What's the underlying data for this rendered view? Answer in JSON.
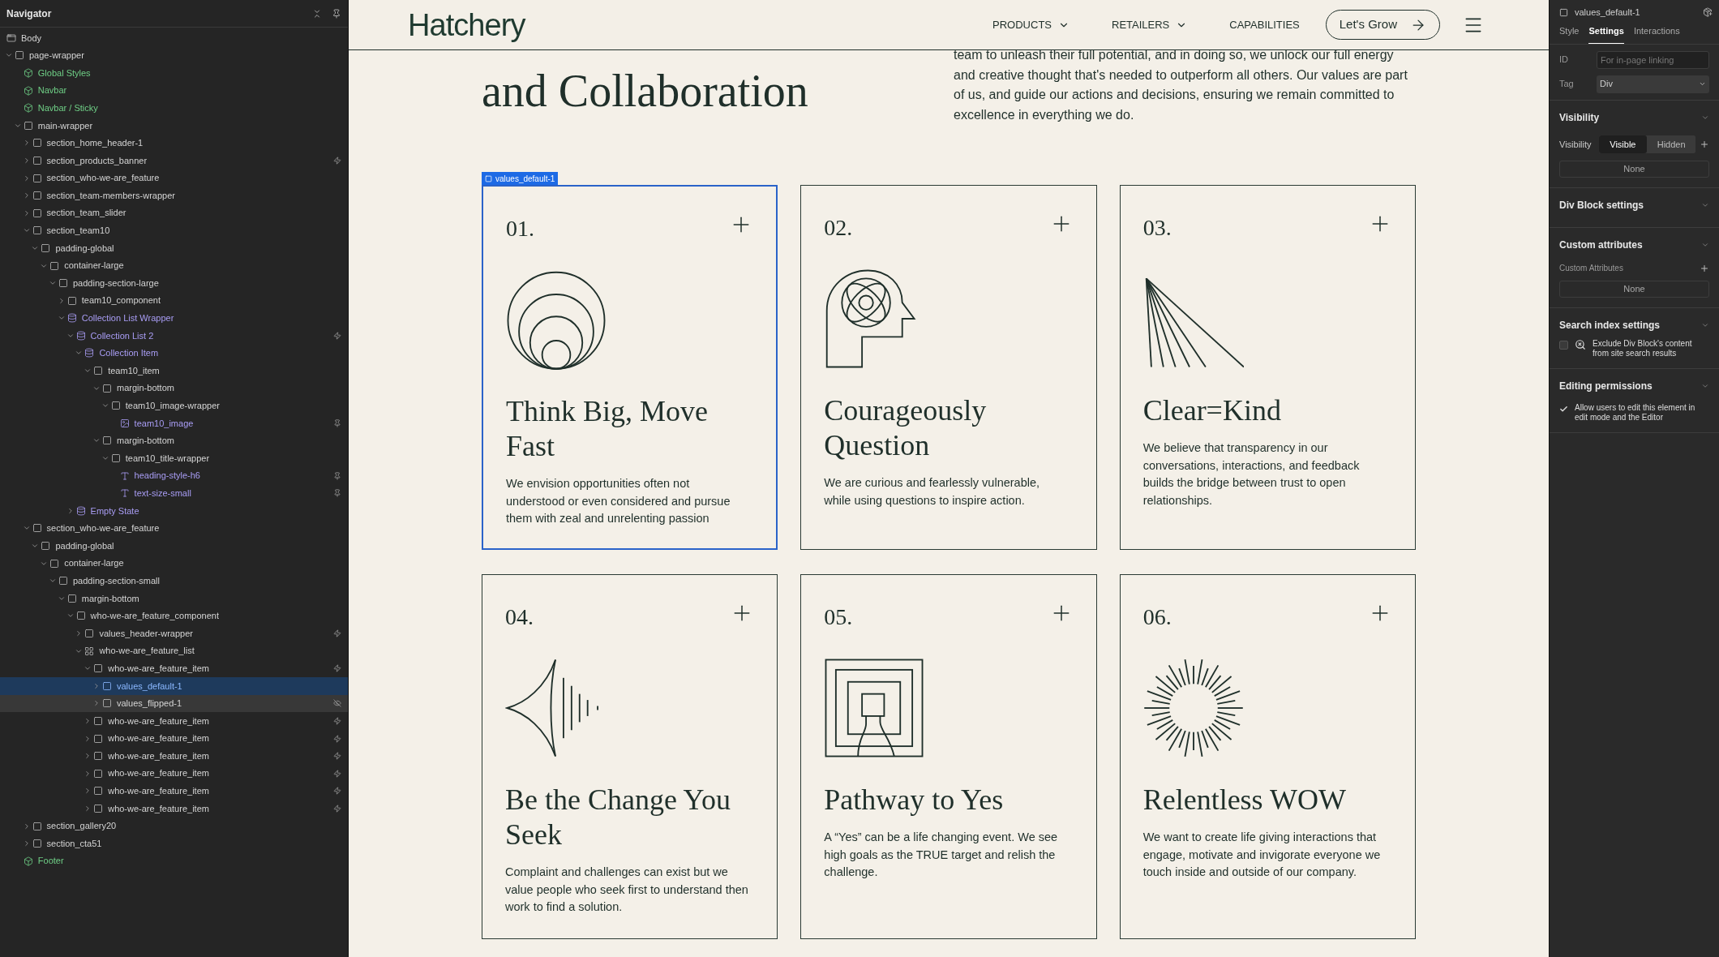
{
  "navigator": {
    "title": "Navigator",
    "tree": [
      {
        "label": "Body",
        "kind": "body",
        "selected": false,
        "hovered": false,
        "children": [
          {
            "label": "page-wrapper",
            "kind": "element",
            "expanded": true,
            "selected": false,
            "hovered": false,
            "children": [
              {
                "label": "Global Styles",
                "kind": "component",
                "selected": false,
                "hovered": false
              },
              {
                "label": "Navbar",
                "kind": "component",
                "selected": false,
                "hovered": false
              },
              {
                "label": "Navbar / Sticky",
                "kind": "component",
                "selected": false,
                "hovered": false
              },
              {
                "label": "main-wrapper",
                "kind": "element",
                "expanded": true,
                "selected": false,
                "hovered": false,
                "children": [
                  {
                    "label": "section_home_header-1",
                    "kind": "element",
                    "expanded": false,
                    "selected": false,
                    "hovered": false
                  },
                  {
                    "label": "section_products_banner",
                    "kind": "element",
                    "expanded": false,
                    "selected": false,
                    "hovered": false,
                    "badge": {
                      "kind": "bolt"
                    }
                  },
                  {
                    "label": "section_who-we-are_feature",
                    "kind": "element",
                    "expanded": false,
                    "selected": false,
                    "hovered": false
                  },
                  {
                    "label": "section_team-members-wrapper",
                    "kind": "element",
                    "expanded": false,
                    "selected": false,
                    "hovered": false
                  },
                  {
                    "label": "section_team_slider",
                    "kind": "element",
                    "expanded": false,
                    "selected": false,
                    "hovered": false
                  },
                  {
                    "label": "section_team10",
                    "kind": "element",
                    "expanded": true,
                    "selected": false,
                    "hovered": false,
                    "children": [
                      {
                        "label": "padding-global",
                        "kind": "element",
                        "expanded": true,
                        "selected": false,
                        "hovered": false,
                        "children": [
                          {
                            "label": "container-large",
                            "kind": "element",
                            "expanded": true,
                            "selected": false,
                            "hovered": false,
                            "children": [
                              {
                                "label": "padding-section-large",
                                "kind": "element",
                                "expanded": true,
                                "selected": false,
                                "hovered": false,
                                "children": [
                                  {
                                    "label": "team10_component",
                                    "kind": "element",
                                    "expanded": false,
                                    "selected": false,
                                    "hovered": false
                                  },
                                  {
                                    "label": "Collection List Wrapper",
                                    "kind": "collection",
                                    "expanded": true,
                                    "selected": false,
                                    "hovered": false,
                                    "children": [
                                      {
                                        "label": "Collection List 2",
                                        "kind": "collection",
                                        "expanded": true,
                                        "selected": false,
                                        "hovered": false,
                                        "badge": {
                                          "kind": "bolt"
                                        },
                                        "children": [
                                          {
                                            "label": "Collection Item",
                                            "kind": "collection",
                                            "expanded": true,
                                            "selected": false,
                                            "hovered": false,
                                            "children": [
                                              {
                                                "label": "team10_item",
                                                "kind": "element",
                                                "expanded": true,
                                                "selected": false,
                                                "hovered": false,
                                                "children": [
                                                  {
                                                    "label": "margin-bottom",
                                                    "kind": "element",
                                                    "expanded": true,
                                                    "selected": false,
                                                    "hovered": false,
                                                    "children": [
                                                      {
                                                        "label": "team10_image-wrapper",
                                                        "kind": "element",
                                                        "expanded": true,
                                                        "selected": false,
                                                        "hovered": false,
                                                        "children": [
                                                          {
                                                            "label": "team10_image",
                                                            "kind": "image",
                                                            "selected": false,
                                                            "hovered": false,
                                                            "badge": {
                                                              "kind": "pin"
                                                            }
                                                          }
                                                        ]
                                                      }
                                                    ]
                                                  },
                                                  {
                                                    "label": "margin-bottom",
                                                    "kind": "element",
                                                    "expanded": true,
                                                    "selected": false,
                                                    "hovered": false,
                                                    "children": [
                                                      {
                                                        "label": "team10_title-wrapper",
                                                        "kind": "element",
                                                        "expanded": true,
                                                        "selected": false,
                                                        "hovered": false,
                                                        "children": [
                                                          {
                                                            "label": "heading-style-h6",
                                                            "kind": "text",
                                                            "selected": false,
                                                            "hovered": false,
                                                            "badge": {
                                                              "kind": "pin"
                                                            }
                                                          },
                                                          {
                                                            "label": "text-size-small",
                                                            "kind": "text",
                                                            "selected": false,
                                                            "hovered": false,
                                                            "badge": {
                                                              "kind": "pin"
                                                            }
                                                          }
                                                        ]
                                                      }
                                                    ]
                                                  }
                                                ]
                                              }
                                            ]
                                          }
                                        ]
                                      },
                                      {
                                        "label": "Empty State",
                                        "kind": "collection",
                                        "expanded": false,
                                        "selected": false,
                                        "hovered": false
                                      }
                                    ]
                                  }
                                ]
                              }
                            ]
                          }
                        ]
                      }
                    ]
                  },
                  {
                    "label": "section_who-we-are_feature",
                    "kind": "element",
                    "expanded": true,
                    "selected": false,
                    "hovered": false,
                    "children": [
                      {
                        "label": "padding-global",
                        "kind": "element",
                        "expanded": true,
                        "selected": false,
                        "hovered": false,
                        "children": [
                          {
                            "label": "container-large",
                            "kind": "element",
                            "expanded": true,
                            "selected": false,
                            "hovered": false,
                            "children": [
                              {
                                "label": "padding-section-small",
                                "kind": "element",
                                "expanded": true,
                                "selected": false,
                                "hovered": false,
                                "children": [
                                  {
                                    "label": "margin-bottom",
                                    "kind": "element",
                                    "expanded": true,
                                    "selected": false,
                                    "hovered": false,
                                    "children": [
                                      {
                                        "label": "who-we-are_feature_component",
                                        "kind": "element",
                                        "expanded": true,
                                        "selected": false,
                                        "hovered": false,
                                        "children": [
                                          {
                                            "label": "values_header-wrapper",
                                            "kind": "element",
                                            "expanded": false,
                                            "selected": false,
                                            "hovered": false,
                                            "badge": {
                                              "kind": "bolt"
                                            }
                                          },
                                          {
                                            "label": "who-we-are_feature_list",
                                            "kind": "grid",
                                            "expanded": true,
                                            "selected": false,
                                            "hovered": false,
                                            "children": [
                                              {
                                                "label": "who-we-are_feature_item",
                                                "kind": "element",
                                                "expanded": true,
                                                "selected": false,
                                                "hovered": false,
                                                "badge": {
                                                  "kind": "bolt"
                                                },
                                                "children": [
                                                  {
                                                    "label": "values_default-1",
                                                    "kind": "element",
                                                    "expanded": false,
                                                    "selected": true,
                                                    "hovered": false
                                                  },
                                                  {
                                                    "label": "values_flipped-1",
                                                    "kind": "element",
                                                    "expanded": false,
                                                    "selected": false,
                                                    "hovered": true,
                                                    "badge": {
                                                      "kind": "hidden"
                                                    }
                                                  }
                                                ]
                                              },
                                              {
                                                "label": "who-we-are_feature_item",
                                                "kind": "element",
                                                "expanded": false,
                                                "selected": false,
                                                "hovered": false,
                                                "badge": {
                                                  "kind": "bolt"
                                                }
                                              },
                                              {
                                                "label": "who-we-are_feature_item",
                                                "kind": "element",
                                                "expanded": false,
                                                "selected": false,
                                                "hovered": false,
                                                "badge": {
                                                  "kind": "bolt"
                                                }
                                              },
                                              {
                                                "label": "who-we-are_feature_item",
                                                "kind": "element",
                                                "expanded": false,
                                                "selected": false,
                                                "hovered": false,
                                                "badge": {
                                                  "kind": "bolt"
                                                }
                                              },
                                              {
                                                "label": "who-we-are_feature_item",
                                                "kind": "element",
                                                "expanded": false,
                                                "selected": false,
                                                "hovered": false,
                                                "badge": {
                                                  "kind": "bolt"
                                                }
                                              },
                                              {
                                                "label": "who-we-are_feature_item",
                                                "kind": "element",
                                                "expanded": false,
                                                "selected": false,
                                                "hovered": false,
                                                "badge": {
                                                  "kind": "bolt"
                                                }
                                              },
                                              {
                                                "label": "who-we-are_feature_item",
                                                "kind": "element",
                                                "expanded": false,
                                                "selected": false,
                                                "hovered": false,
                                                "badge": {
                                                  "kind": "bolt"
                                                }
                                              }
                                            ]
                                          }
                                        ]
                                      }
                                    ]
                                  }
                                ]
                              }
                            ]
                          }
                        ]
                      }
                    ]
                  },
                  {
                    "label": "section_gallery20",
                    "kind": "element",
                    "expanded": false,
                    "selected": false,
                    "hovered": false
                  },
                  {
                    "label": "section_cta51",
                    "kind": "element",
                    "expanded": false,
                    "selected": false,
                    "hovered": false
                  }
                ]
              },
              {
                "label": "Footer",
                "kind": "component",
                "selected": false,
                "hovered": false
              }
            ]
          }
        ]
      }
    ]
  },
  "canvas": {
    "navbar": {
      "logo": "Hatchery",
      "links": [
        {
          "label": "PRODUCTS",
          "dropdown": true
        },
        {
          "label": "RETAILERS",
          "dropdown": true
        },
        {
          "label": "CAPABILITIES",
          "dropdown": false
        }
      ],
      "cta": "Let's Grow"
    },
    "heading": "and Collaboration",
    "intro": "team to unleash their full potential, and in doing so, we unlock our full energy and creative thought that's needed to outperform all others. Our values are part of us, and guide our actions and decisions, ensuring we remain committed to excellence in everything we do.",
    "selection_label": "values_default-1",
    "cards": [
      {
        "number": "01.",
        "title": "Think Big, Move Fast",
        "text": "We envision opportunities often not understood or even considered and pursue them with zeal and unrelenting passion",
        "selected": true
      },
      {
        "number": "02.",
        "title": "Courageously Question",
        "text": "We are curious and fearlessly vulnerable, while using questions to inspire action.",
        "selected": false
      },
      {
        "number": "03.",
        "title": "Clear=Kind",
        "text": "We believe that transparency in our conversations, interactions, and feedback builds the bridge between trust to open relationships.",
        "selected": false
      },
      {
        "number": "04.",
        "title": "Be the Change You Seek",
        "text": "Complaint and challenges can exist but we value people who seek first to understand then work to find a solution.",
        "selected": false
      },
      {
        "number": "05.",
        "title": "Pathway to Yes",
        "text": "A “Yes” can be a life changing event. We see high goals as the TRUE target and relish the challenge.",
        "selected": false
      },
      {
        "number": "06.",
        "title": "Relentless WOW",
        "text": "We want to create life giving interactions that engage, motivate and invigorate everyone we touch inside and outside of our company.",
        "selected": false
      }
    ]
  },
  "settings": {
    "element": "values_default-1",
    "tabs": [
      {
        "label": "Style",
        "selected": false
      },
      {
        "label": "Settings",
        "selected": true
      },
      {
        "label": "Interactions",
        "selected": false
      }
    ],
    "id_label": "ID",
    "id_placeholder": "For in-page linking",
    "tag_label": "Tag",
    "tag_value": "Div",
    "visibility": {
      "heading": "Visibility",
      "label": "Visibility",
      "options": [
        {
          "label": "Visible",
          "selected": true
        },
        {
          "label": "Hidden",
          "selected": false
        }
      ],
      "conditions": "None"
    },
    "div_block": {
      "heading": "Div Block settings"
    },
    "custom_attributes": {
      "heading": "Custom attributes",
      "label": "Custom Attributes",
      "value": "None"
    },
    "search_index": {
      "heading": "Search index settings",
      "label": "Exclude Div Block's content from site search results",
      "checked": false
    },
    "editing": {
      "heading": "Editing permissions",
      "label": "Allow users to edit this element in edit mode and the Editor",
      "checked": true
    }
  }
}
